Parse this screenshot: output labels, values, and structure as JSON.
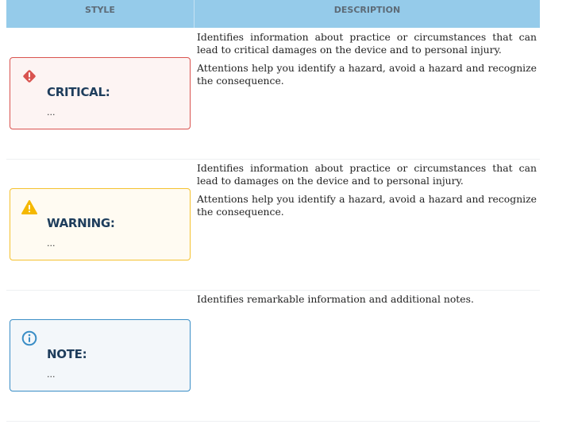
{
  "header": {
    "style": "STYLE",
    "description": "DESCRIPTION"
  },
  "rows": [
    {
      "icon": "exclamation-diamond-icon",
      "title": "CRITICAL:",
      "body": "...",
      "color": "#d9534f",
      "bg": "#fdf4f3",
      "desc": [
        "Identifies information about practice or circumstances that can lead to critical damages on the device and to personal injury.",
        "Attentions help you identify a hazard, avoid a hazard and recognize the consequence."
      ]
    },
    {
      "icon": "warning-triangle-icon",
      "title": "WARNING:",
      "body": "...",
      "color": "#f5c12e",
      "bg": "#fffbf2",
      "desc": [
        "Identifies information about practice or circumstances that can lead to damages on the device and to personal injury.",
        "Attentions help you identify a hazard, avoid a hazard and recognize the consequence."
      ]
    },
    {
      "icon": "info-circle-icon",
      "title": "NOTE:",
      "body": "...",
      "color": "#3a8ec6",
      "bg": "#f3f7fa",
      "desc": [
        "Identifies remarkable information and additional notes."
      ]
    }
  ]
}
